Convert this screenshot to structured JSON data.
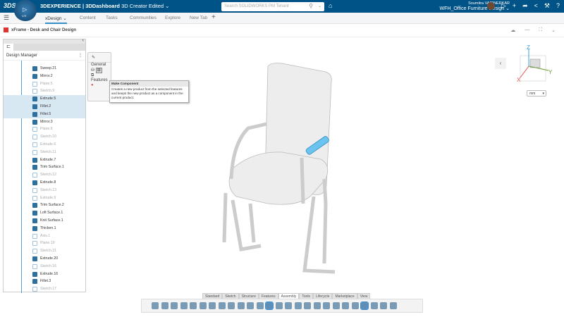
{
  "topbar": {
    "logo": "3DS",
    "compass_version": "V.R",
    "app_title_bold": "3DEXPERIENCE | 3DDashboard",
    "app_title_rest": "3D Creator Edited ⌄",
    "search_placeholder": "Search SOLIDWORKS PM Tenant",
    "user_name": "Soumitra VAIDNERKAR",
    "workspace": "WFH_Office Furniture Design ⌄"
  },
  "tabs": [
    {
      "label": "xDesign ⌄",
      "active": true
    },
    {
      "label": "Content"
    },
    {
      "label": "Tasks"
    },
    {
      "label": "Communities"
    },
    {
      "label": "Explore"
    },
    {
      "label": "New Tab"
    },
    {
      "label": "+"
    }
  ],
  "document": {
    "title": "xFrame - Desk and Chair Design"
  },
  "panel": {
    "title": "Design Manager",
    "menu": "⋮",
    "collapse": "‹",
    "items": [
      {
        "label": "Sweep.21"
      },
      {
        "label": "Mirror.2"
      },
      {
        "label": "Plane.5",
        "faded": true
      },
      {
        "label": "Sketch.9",
        "faded": true
      },
      {
        "label": "Extrude.5",
        "selected": true
      },
      {
        "label": "Fillet.2",
        "selected": true
      },
      {
        "label": "Fillet.5",
        "selected": true
      },
      {
        "label": "Mirror.3"
      },
      {
        "label": "Plane.6",
        "faded": true
      },
      {
        "label": "Sketch.10",
        "faded": true
      },
      {
        "label": "Extrude.6",
        "faded": true
      },
      {
        "label": "Sketch.11",
        "faded": true
      },
      {
        "label": "Extrude.7"
      },
      {
        "label": "Trim Surface.1"
      },
      {
        "label": "Sketch.12",
        "faded": true
      },
      {
        "label": "Extrude.8"
      },
      {
        "label": "Sketch.13",
        "faded": true
      },
      {
        "label": "Extrude.9",
        "faded": true
      },
      {
        "label": "Trim Surface.2"
      },
      {
        "label": "Loft Surface.1"
      },
      {
        "label": "Knit Surface.1"
      },
      {
        "label": "Thicken.1"
      },
      {
        "label": "Axis.1",
        "faded": true
      },
      {
        "label": "Plane.10",
        "faded": true
      },
      {
        "label": "Sketch.21",
        "faded": true
      },
      {
        "label": "Extrude.20"
      },
      {
        "label": "Sketch.16",
        "faded": true
      },
      {
        "label": "Extrude.16"
      },
      {
        "label": "Fillet.3"
      },
      {
        "label": "Sketch.17",
        "faded": true
      }
    ]
  },
  "popup": {
    "general": "General",
    "features": "Features"
  },
  "tooltip": {
    "title": "Make Component",
    "desc": "Creates a new product from the selected features and keeps the new product as a component in the current product."
  },
  "viewcube": {
    "z": "Z",
    "y": "Y",
    "x": "X"
  },
  "units": "mm",
  "bottom_tabs": [
    {
      "label": "Standard"
    },
    {
      "label": "Sketch"
    },
    {
      "label": "Structure"
    },
    {
      "label": "Features"
    },
    {
      "label": "Assembly",
      "active": true
    },
    {
      "label": "Tools"
    },
    {
      "label": "Lifecycle"
    },
    {
      "label": "Marketplace"
    },
    {
      "label": "View"
    }
  ],
  "colors": {
    "brand": "#005386",
    "accent": "#368ec4",
    "selection": "#d8e8f3",
    "highlight": "#3fa9e0"
  }
}
